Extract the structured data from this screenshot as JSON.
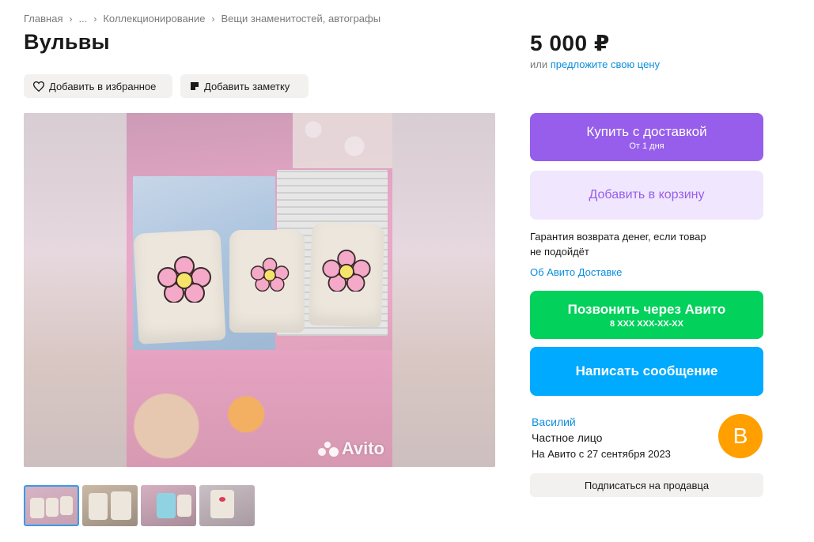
{
  "breadcrumb": {
    "items": [
      "Главная",
      "...",
      "Коллекционирование",
      "Вещи знаменитостей, автографы"
    ]
  },
  "title": "Вульвы",
  "actions": {
    "favorite_label": "Добавить в избранное",
    "note_label": "Добавить заметку"
  },
  "gallery": {
    "watermark": "Avito",
    "thumbnail_count": 4
  },
  "price": {
    "value": "5 000 ₽",
    "offer_prefix": "или",
    "offer_link": "предложите свою цену"
  },
  "buttons": {
    "buy_label": "Купить с доставкой",
    "buy_sub": "От 1 дня",
    "cart_label": "Добавить в корзину",
    "call_label": "Позвонить через Авито",
    "call_sub": "8 XXX XXX-XX-XX",
    "message_label": "Написать сообщение"
  },
  "guarantee": {
    "line1": "Гарантия возврата денег, если товар",
    "line2": "не подойдёт",
    "delivery_link": "Об Авито Доставке"
  },
  "seller": {
    "name": "Василий",
    "type": "Частное лицо",
    "since": "На Авито с 27 сентября 2023",
    "avatar_letter": "В",
    "subscribe_label": "Подписаться на продавца"
  },
  "colors": {
    "buy": "#965eeb",
    "cart_bg": "#f0e6fd",
    "call": "#02d15c",
    "message": "#00aaff",
    "link": "#0a8ddc",
    "avatar": "#ff9f00"
  }
}
